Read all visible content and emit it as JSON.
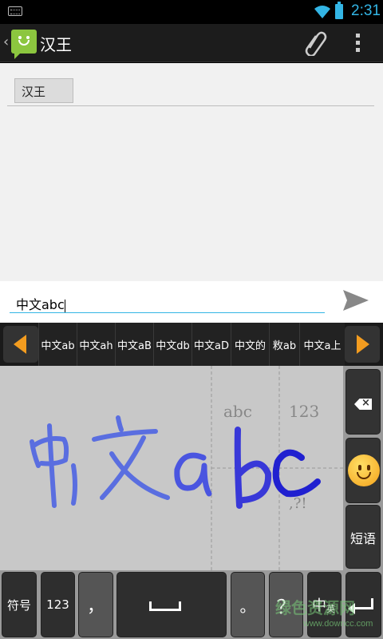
{
  "status_bar": {
    "time": "2:31"
  },
  "action_bar": {
    "title": "汉王"
  },
  "compose": {
    "recipient": "汉王",
    "message_text": "中文abc"
  },
  "candidates": [
    "中文ab",
    "中文ah",
    "中文aB",
    "中文db",
    "中文aD",
    "中文的",
    "敉ab",
    "中文a上"
  ],
  "handwriting": {
    "mode_abc": "abc",
    "mode_123": "123",
    "mode_punct": ",?!",
    "ink_text": "中文abc"
  },
  "right_keys": {
    "phrase": "短语"
  },
  "bottom_keys": {
    "symbols": "符号",
    "numbers": "123",
    "comma": "，",
    "period": "。",
    "question": "？",
    "lang": "中",
    "lang_sub": "英"
  },
  "colors": {
    "accent": "#33b5e5",
    "ink": "#3a3adc",
    "arrow": "#f39c1f"
  },
  "watermark": {
    "text": "绿色资源网",
    "url": "www.downcc.com"
  }
}
